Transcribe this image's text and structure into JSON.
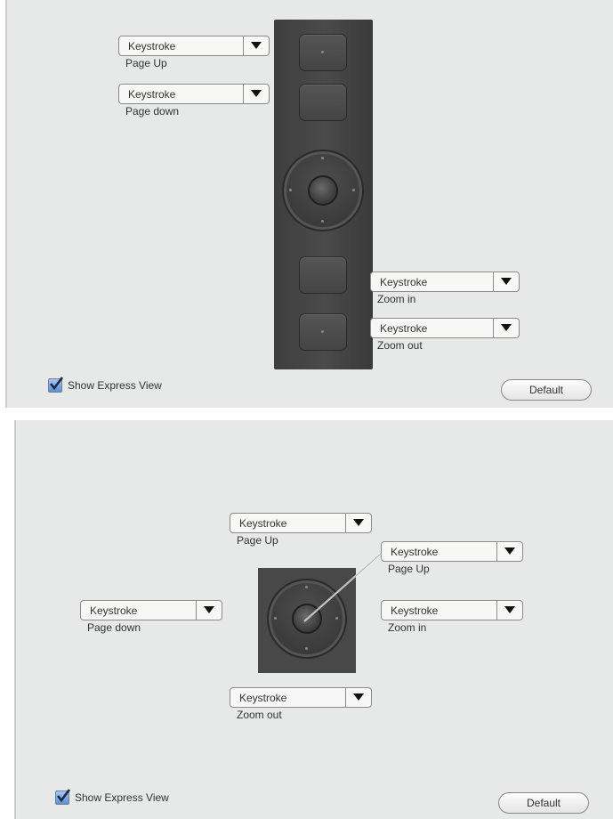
{
  "panel_top": {
    "dropdowns": [
      {
        "value": "Keystroke",
        "caption": "Page Up"
      },
      {
        "value": "Keystroke",
        "caption": "Page down"
      },
      {
        "value": "Keystroke",
        "caption": "Zoom in"
      },
      {
        "value": "Keystroke",
        "caption": "Zoom out"
      }
    ],
    "show_express_view": {
      "label": "Show Express View",
      "checked": true
    },
    "default_button": "Default"
  },
  "panel_bottom": {
    "dropdowns": [
      {
        "value": "Keystroke",
        "caption": "Page Up"
      },
      {
        "value": "Keystroke",
        "caption": "Page Up"
      },
      {
        "value": "Keystroke",
        "caption": "Page down"
      },
      {
        "value": "Keystroke",
        "caption": "Zoom in"
      },
      {
        "value": "Keystroke",
        "caption": "Zoom out"
      }
    ],
    "show_express_view": {
      "label": "Show Express View",
      "checked": true
    },
    "default_button": "Default"
  },
  "icons": {
    "dropdown_arrow": "triangle-down-icon",
    "checkbox": "checkmark-icon"
  },
  "colors": {
    "panel_bg": "#e6e9e7",
    "device": "#444444",
    "checkbox": "#5d8fd6"
  }
}
